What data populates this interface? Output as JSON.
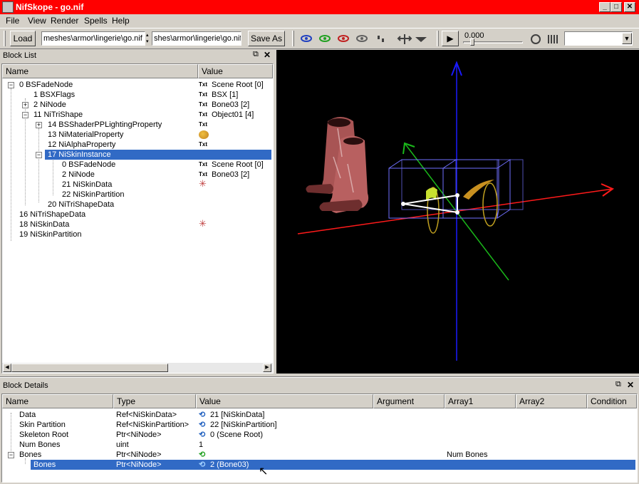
{
  "window": {
    "title": "NifSkope - go.nif"
  },
  "menu": [
    "File",
    "View",
    "Render",
    "Spells",
    "Help"
  ],
  "toolbar": {
    "load_label": "Load",
    "load_path": "meshes\\armor\\lingerie\\go.nif",
    "save_path": "shes\\armor\\lingerie\\go.nif",
    "save_label": "Save As",
    "time_value": "0.000"
  },
  "block_list": {
    "title": "Block List",
    "columns": [
      "Name",
      "Value"
    ],
    "rows": [
      {
        "label": "0  BSFadeNode",
        "value": "Scene Root [0]",
        "tag": "Txt"
      },
      {
        "label": "1  BSXFlags",
        "value": "BSX [1]",
        "tag": "Txt"
      },
      {
        "label": "2  NiNode",
        "value": "Bone03 [2]",
        "tag": "Txt"
      },
      {
        "label": "11  NiTriShape",
        "value": "Object01 [4]",
        "tag": "Txt"
      },
      {
        "label": "14  BSShaderPPLightingProperty",
        "value": "",
        "tag": "Txt"
      },
      {
        "label": "13  NiMaterialProperty",
        "value": "",
        "tag": ""
      },
      {
        "label": "12  NiAlphaProperty",
        "value": "",
        "tag": "Txt"
      },
      {
        "label": "17  NiSkinInstance",
        "value": "",
        "tag": ""
      },
      {
        "label": "0  BSFadeNode",
        "value": "Scene Root [0]",
        "tag": "Txt"
      },
      {
        "label": "2  NiNode",
        "value": "Bone03 [2]",
        "tag": "Txt"
      },
      {
        "label": "21  NiSkinData",
        "value": "",
        "tag": ""
      },
      {
        "label": "22  NiSkinPartition",
        "value": "",
        "tag": ""
      },
      {
        "label": "20  NiTriShapeData",
        "value": "",
        "tag": ""
      },
      {
        "label": "16  NiTriShapeData",
        "value": "",
        "tag": ""
      },
      {
        "label": "18  NiSkinData",
        "value": "",
        "tag": ""
      },
      {
        "label": "19  NiSkinPartition",
        "value": "",
        "tag": ""
      }
    ]
  },
  "block_details": {
    "title": "Block Details",
    "columns": [
      "Name",
      "Type",
      "Value",
      "Argument",
      "Array1",
      "Array2",
      "Condition"
    ],
    "rows": [
      {
        "name": "Data",
        "type": "Ref<NiSkinData>",
        "value": "21 [NiSkinData]",
        "array1": ""
      },
      {
        "name": "Skin Partition",
        "type": "Ref<NiSkinPartition>",
        "value": "22 [NiSkinPartition]",
        "array1": ""
      },
      {
        "name": "Skeleton Root",
        "type": "Ptr<NiNode>",
        "value": "0 (Scene Root)",
        "array1": ""
      },
      {
        "name": "Num Bones",
        "type": "uint",
        "value": "1",
        "array1": ""
      },
      {
        "name": "Bones",
        "type": "Ptr<NiNode>",
        "value": "",
        "array1": "Num Bones"
      },
      {
        "name": "Bones",
        "type": "Ptr<NiNode>",
        "value": "2 (Bone03)",
        "array1": ""
      }
    ]
  },
  "colors": {
    "titlebar": "#ff0000",
    "selection": "#316ac5",
    "viewport": "#000000"
  }
}
